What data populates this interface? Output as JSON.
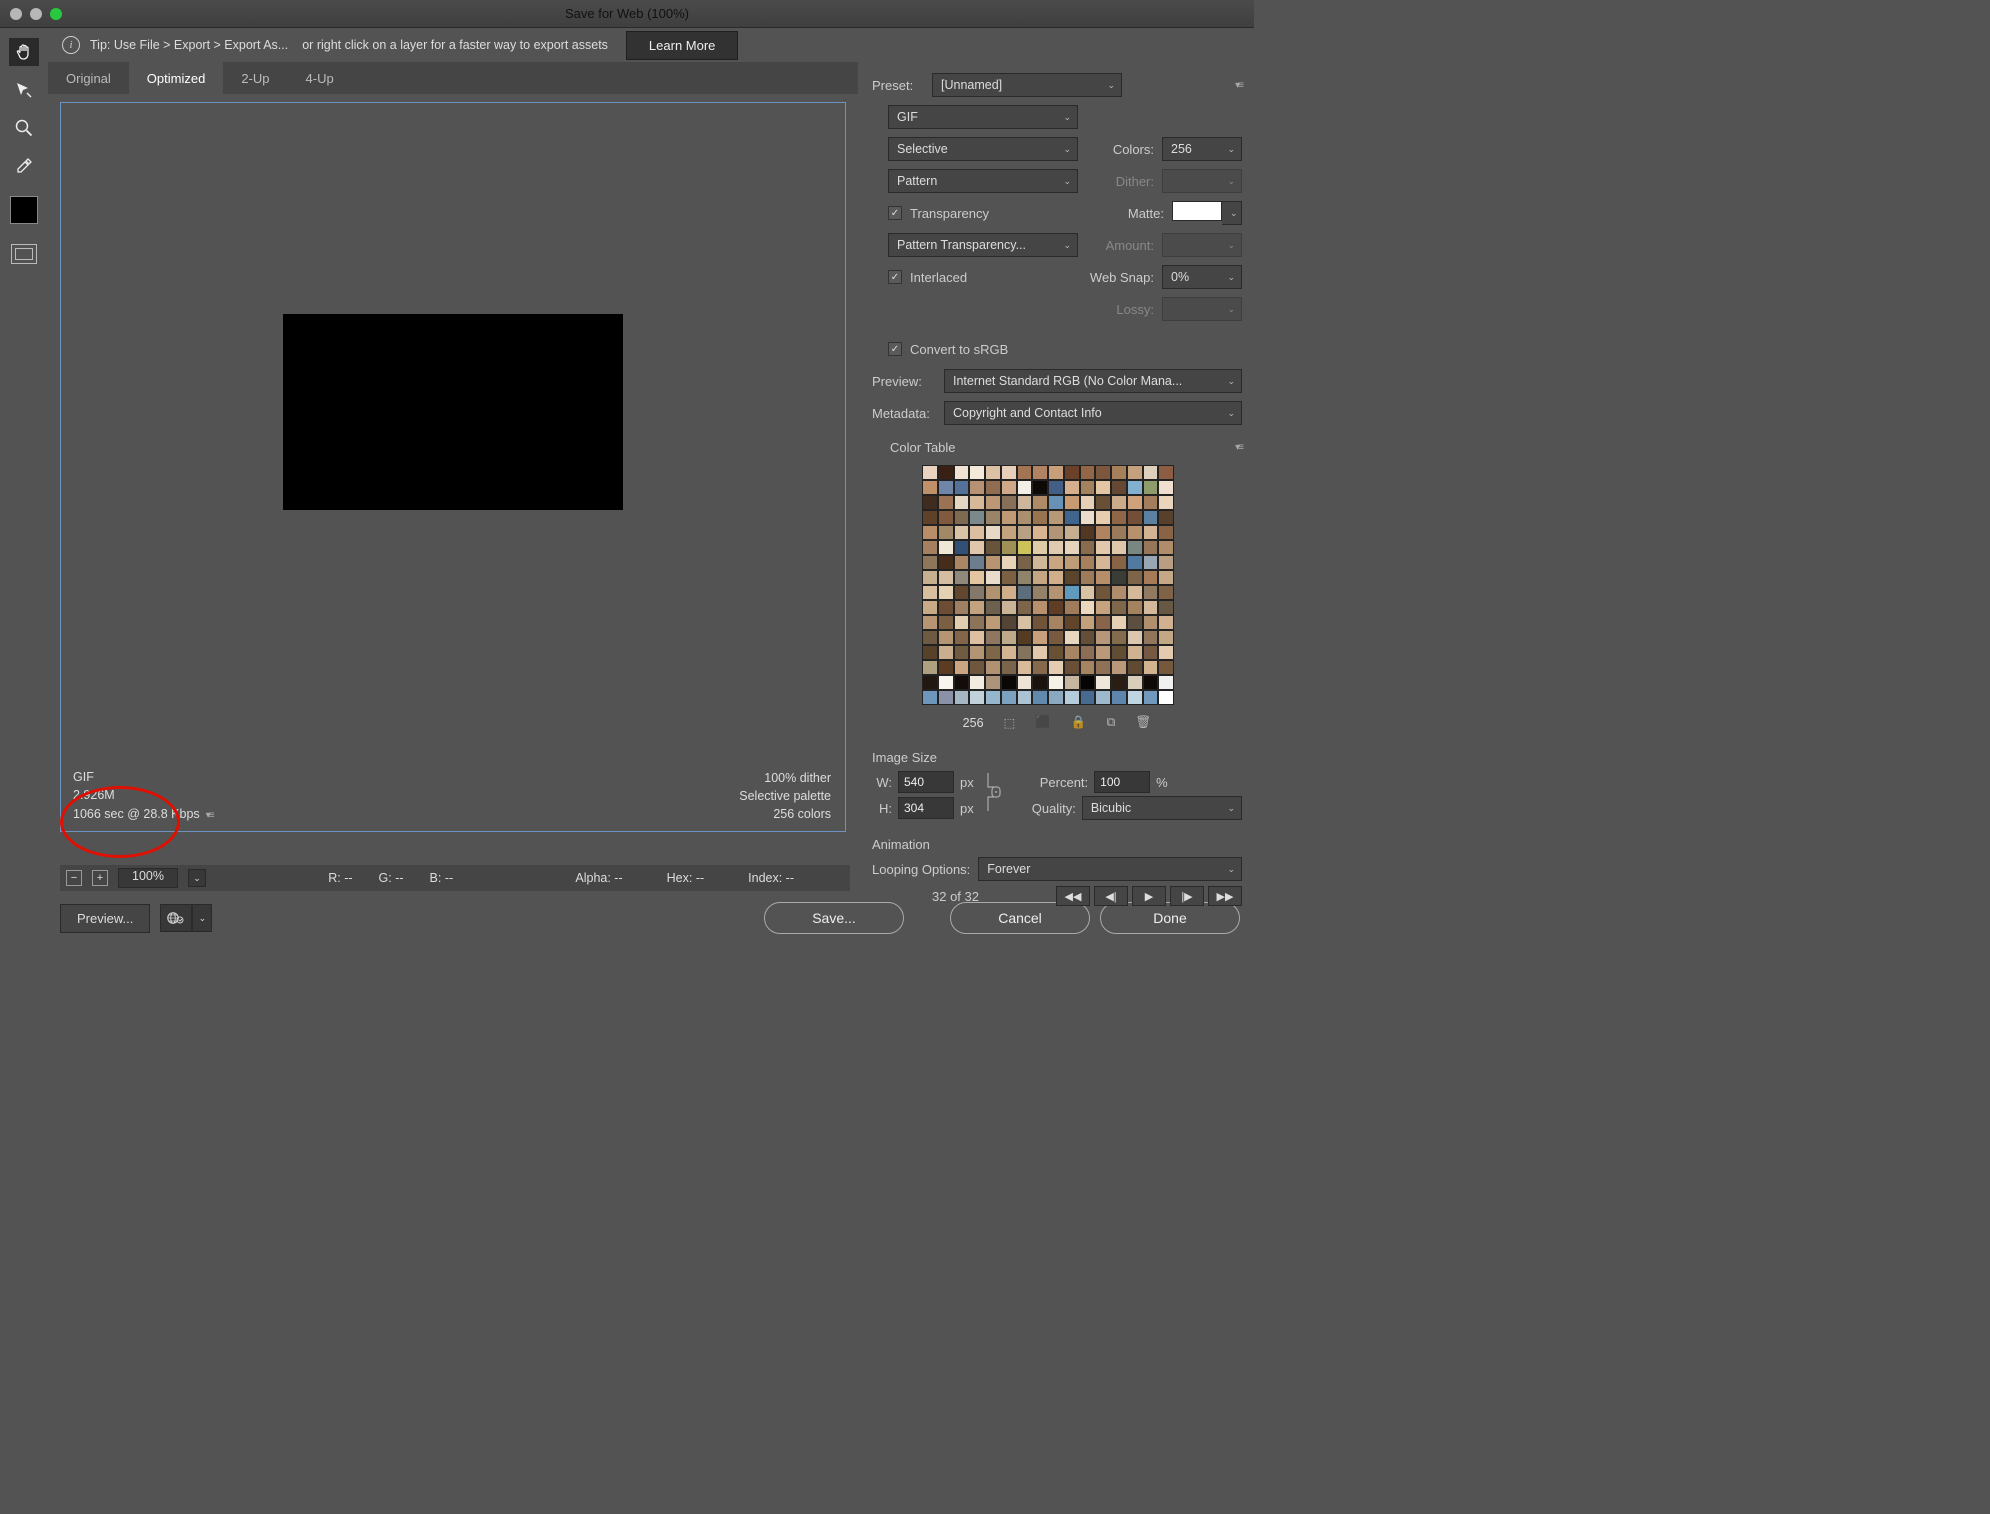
{
  "window": {
    "title": "Save for Web (100%)"
  },
  "tip": {
    "prefix": "Tip: Use File > Export > Export As...",
    "suffix": "or right click on a layer for a faster way to export assets",
    "learn": "Learn More"
  },
  "tabs": {
    "t0": "Original",
    "t1": "Optimized",
    "t2": "2-Up",
    "t3": "4-Up"
  },
  "status": {
    "fmt": "GIF",
    "size": "2.926M",
    "time": "1066 sec @ 28.8 Kbps",
    "dither": "100% dither",
    "palette": "Selective palette",
    "colors": "256 colors"
  },
  "ruler": {
    "zoom": "100%",
    "r": "R: --",
    "g": "G: --",
    "b": "B: --",
    "alpha": "Alpha: --",
    "hex": "Hex: --",
    "index": "Index: --"
  },
  "bottom": {
    "preview": "Preview...",
    "save": "Save...",
    "cancel": "Cancel",
    "done": "Done"
  },
  "preset": {
    "label": "Preset:",
    "value": "[Unnamed]"
  },
  "fmt": {
    "value": "GIF"
  },
  "reduction": {
    "value": "Selective",
    "colorsLabel": "Colors:",
    "colorsVal": "256"
  },
  "ditherM": {
    "value": "Pattern",
    "ditherLabel": "Dither:"
  },
  "transp": {
    "label": "Transparency",
    "matteLabel": "Matte:"
  },
  "transpDither": {
    "value": "Pattern Transparency...",
    "amountLabel": "Amount:"
  },
  "inter": {
    "label": "Interlaced",
    "snapLabel": "Web Snap:",
    "snapVal": "0%"
  },
  "lossy": {
    "label": "Lossy:"
  },
  "srgb": {
    "label": "Convert to sRGB"
  },
  "preview": {
    "label": "Preview:",
    "value": "Internet Standard RGB (No Color Mana..."
  },
  "meta": {
    "label": "Metadata:",
    "value": "Copyright and Contact Info"
  },
  "colorTable": {
    "title": "Color Table",
    "count": "256",
    "palette": [
      "#e9d2c0",
      "#3a1f15",
      "#f0e3d4",
      "#f3ead9",
      "#dcc1a4",
      "#e7cfb9",
      "#a37352",
      "#b28362",
      "#c99f7b",
      "#6a4028",
      "#946648",
      "#7d573d",
      "#a87f5b",
      "#c4a07d",
      "#ded0bd",
      "#8c5d43",
      "#c0906b",
      "#6f86a9",
      "#547199",
      "#b69172",
      "#926c51",
      "#cfa987",
      "#f3efe6",
      "#0e0906",
      "#445f85",
      "#d6b08c",
      "#a2835e",
      "#e4c6a5",
      "#644833",
      "#82b1cf",
      "#8e9b6b",
      "#f0dfcf",
      "#3f2c1e",
      "#9b7253",
      "#e4d6c2",
      "#d7b99a",
      "#bb9776",
      "#887058",
      "#cdb69b",
      "#ae8a67",
      "#6791b5",
      "#c79a71",
      "#e6d0b5",
      "#6a4f37",
      "#cbab8a",
      "#d0a27a",
      "#a47d5c",
      "#ead5bc",
      "#5f4129",
      "#80593e",
      "#7e6a51",
      "#7b888c",
      "#9a8468",
      "#c09975",
      "#ab906f",
      "#97744f",
      "#b79877",
      "#3f658c",
      "#eaddcb",
      "#e5cdae",
      "#8e6748",
      "#744e36",
      "#5c809f",
      "#57412c",
      "#b98d67",
      "#a18867",
      "#d8c3a6",
      "#dbbfa0",
      "#e7d9c6",
      "#c5a37f",
      "#b8a084",
      "#d8b491",
      "#b19576",
      "#c5ae8f",
      "#523722",
      "#af8561",
      "#997a5a",
      "#b7916b",
      "#d2b495",
      "#8a6245",
      "#a48060",
      "#efe6d5",
      "#324f75",
      "#dfc5aa",
      "#68533b",
      "#9f9055",
      "#cdc25a",
      "#dccba6",
      "#e0cbb2",
      "#e5d3bb",
      "#876c4e",
      "#e2c8ac",
      "#dec7ab",
      "#7a8680",
      "#957659",
      "#af8d6a",
      "#8d765a",
      "#462d1a",
      "#aa8665",
      "#6c7d8f",
      "#b99471",
      "#e8d2b8",
      "#786249",
      "#d0b797",
      "#c9a682",
      "#bf9c78",
      "#a67f5e",
      "#d5b697",
      "#886447",
      "#5279a0",
      "#98a7b3",
      "#ba9e81",
      "#c7b08f",
      "#d4bda0",
      "#90887a",
      "#e3c5a1",
      "#e9dcca",
      "#7c6043",
      "#8f836b",
      "#c4a683",
      "#d1ae8b",
      "#5a442b",
      "#9d7b5a",
      "#b68f6a",
      "#3a3c36",
      "#7e654a",
      "#a67c58",
      "#c5a886",
      "#d8be9f",
      "#e4d1b2",
      "#62472e",
      "#83786a",
      "#b2936f",
      "#cfae89",
      "#5c6e7c",
      "#958168",
      "#b49372",
      "#609bbd",
      "#dac3a2",
      "#6f553a",
      "#af8d6c",
      "#d5b899",
      "#917962",
      "#806247",
      "#c9aa86",
      "#6d4d33",
      "#a08062",
      "#c4a27d",
      "#6d614d",
      "#cab396",
      "#7d654b",
      "#b8906b",
      "#5f3e25",
      "#a17c5b",
      "#edd8bf",
      "#c5a37e",
      "#7f674b",
      "#a4825e",
      "#d3b89a",
      "#665842",
      "#b79472",
      "#7b5f43",
      "#e2cdb1",
      "#8c735a",
      "#bd9b77",
      "#534436",
      "#d8c0a4",
      "#715339",
      "#a78461",
      "#61452a",
      "#c2a07b",
      "#87644a",
      "#e5d0b4",
      "#5d4f40",
      "#af8f6d",
      "#d1b191",
      "#6e5a43",
      "#b59572",
      "#836549",
      "#dfbfa2",
      "#8e7660",
      "#beaa8b",
      "#553b22",
      "#c79f7b",
      "#785a41",
      "#e8d5be",
      "#654e37",
      "#b6977a",
      "#856b4e",
      "#dcc6af",
      "#91765b",
      "#c3a886",
      "#58412b",
      "#cbae8e",
      "#6f5b40",
      "#b39474",
      "#7e6749",
      "#d4b593",
      "#83735d",
      "#e1c8ac",
      "#695035",
      "#a78563",
      "#8c6e56",
      "#b99978",
      "#614c34",
      "#d0b290",
      "#755942",
      "#e4cbb0",
      "#afa17f",
      "#5b3c22",
      "#cca581",
      "#6e573c",
      "#b09272",
      "#7a644c",
      "#d8ba9a",
      "#86684c",
      "#e3ccb1",
      "#694f35",
      "#a58462",
      "#8f7158",
      "#b99979",
      "#604b32",
      "#d1b390",
      "#75593f",
      "#221812",
      "#f8f5ed",
      "#130c08",
      "#f2ebe0",
      "#ac9379",
      "#0b0704",
      "#ede4d5",
      "#1a120d",
      "#f6f1e6",
      "#c6b69f",
      "#060402",
      "#efe7da",
      "#2a1d14",
      "#d9ceb9",
      "#100a06",
      "#f0f0f0",
      "#6e95ba",
      "#8b92a8",
      "#a5b7c4",
      "#c1d1db",
      "#96b6cd",
      "#7ca2c0",
      "#abc3d3",
      "#6188ad",
      "#8aa8c0",
      "#b3cbdb",
      "#476a90",
      "#9eb9cc",
      "#5e85ab",
      "#c0d5e2",
      "#7198bd",
      "#ffffff"
    ]
  },
  "imageSize": {
    "title": "Image Size",
    "wLabel": "W:",
    "wVal": "540",
    "wUnit": "px",
    "hLabel": "H:",
    "hVal": "304",
    "hUnit": "px",
    "pctLabel": "Percent:",
    "pctVal": "100",
    "pctUnit": "%",
    "qLabel": "Quality:",
    "qVal": "Bicubic"
  },
  "anim": {
    "title": "Animation",
    "loopLabel": "Looping Options:",
    "loopVal": "Forever",
    "frame": "32 of 32"
  }
}
